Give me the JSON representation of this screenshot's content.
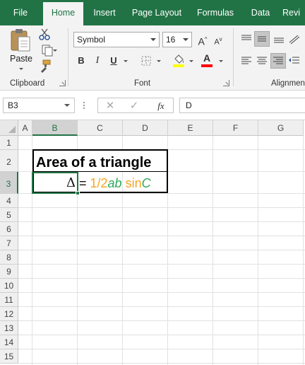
{
  "tabs": [
    {
      "label": "File",
      "active": false
    },
    {
      "label": "Home",
      "active": true
    },
    {
      "label": "Insert",
      "active": false
    },
    {
      "label": "Page Layout",
      "active": false
    },
    {
      "label": "Formulas",
      "active": false
    },
    {
      "label": "Data",
      "active": false
    },
    {
      "label": "Revi",
      "active": false
    }
  ],
  "ribbon": {
    "clipboard": {
      "paste_label": "Paste",
      "group_label": "Clipboard"
    },
    "font": {
      "font_name": "Symbol",
      "font_size": "16",
      "bold": "B",
      "italic": "I",
      "underline": "U",
      "grow": "A",
      "shrink": "A",
      "font_color_letter": "A",
      "highlight_color": "#ffff00",
      "font_color": "#ff0000",
      "group_label": "Font"
    },
    "alignment": {
      "group_label": "Alignmen"
    }
  },
  "formula_bar": {
    "name_box": "B3",
    "fx_label": "fx",
    "content": "D"
  },
  "sheet": {
    "columns": [
      "A",
      "B",
      "C",
      "D",
      "E",
      "F",
      "G"
    ],
    "rows": [
      "1",
      "2",
      "3",
      "4",
      "5",
      "6",
      "7",
      "8",
      "9",
      "10",
      "11",
      "12",
      "13",
      "14",
      "15"
    ],
    "selected_cell": "B3",
    "b2_title": "Area of a triangle",
    "b3_value": "Δ",
    "c3_parts": {
      "eq": "= ",
      "half": "1/2",
      "ab": "ab",
      "sin": " sin",
      "c": "C"
    },
    "colors": {
      "accent": "#217346",
      "orange": "#f5a623",
      "green": "#2ca85a"
    }
  }
}
